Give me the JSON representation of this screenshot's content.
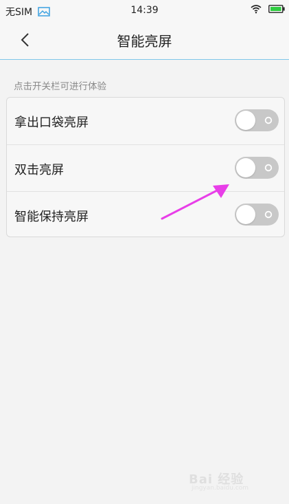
{
  "status_bar": {
    "carrier": "无SIM",
    "time": "14:39",
    "icons": [
      "image-icon",
      "wifi-icon",
      "battery-icon"
    ],
    "battery_color": "#2ecc40"
  },
  "header": {
    "title": "智能亮屏",
    "back_icon": "chevron-left-icon",
    "divider_color": "#7fc6e9"
  },
  "section": {
    "hint": "点击开关栏可进行体验"
  },
  "settings": [
    {
      "label": "拿出口袋亮屏",
      "enabled": false
    },
    {
      "label": "双击亮屏",
      "enabled": false
    },
    {
      "label": "智能保持亮屏",
      "enabled": false
    }
  ],
  "annotation": {
    "type": "arrow",
    "color": "#e83ee8"
  },
  "watermark": {
    "text": "Bai 经验",
    "url": "jingyan.baidu.com"
  }
}
